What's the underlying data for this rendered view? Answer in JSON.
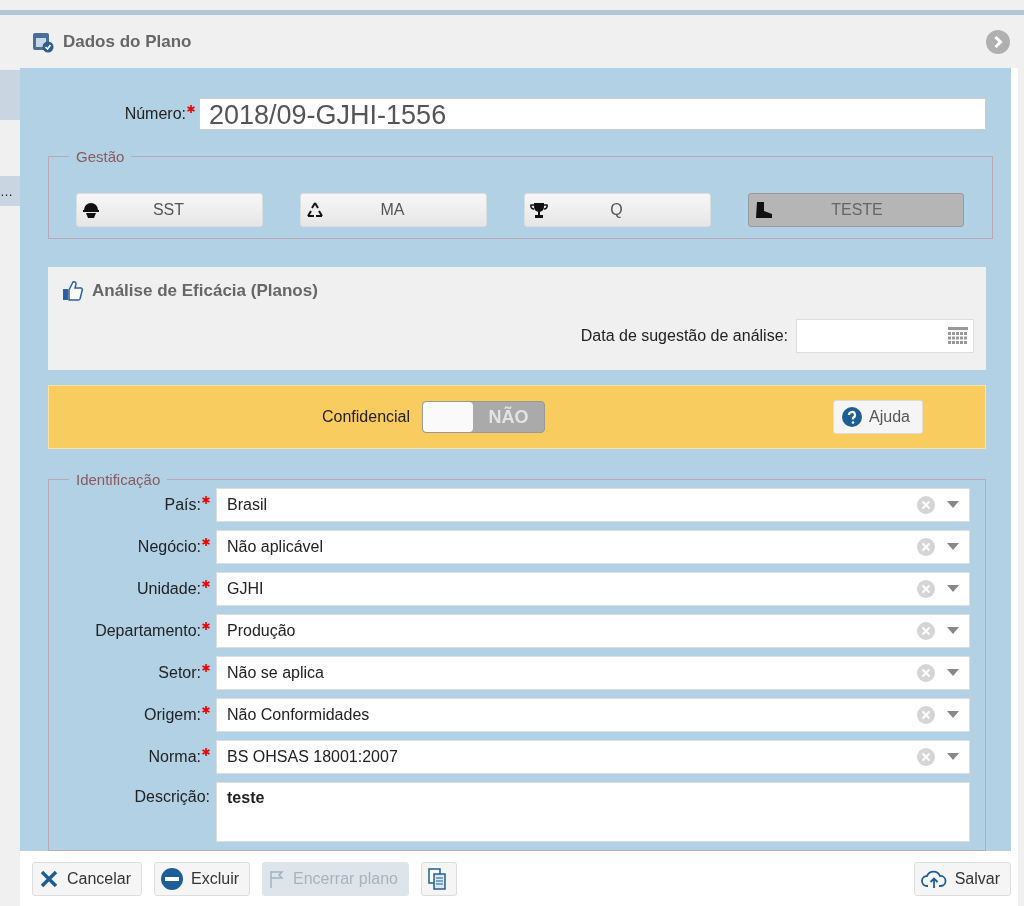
{
  "background": {
    "cut_text": "…"
  },
  "window": {
    "title": "Dados do Plano"
  },
  "numero": {
    "label": "Número:",
    "required": true,
    "value": "2018/09-GJHI-1556"
  },
  "gestao": {
    "legend": "Gestão",
    "buttons": [
      {
        "label": "SST",
        "kind": "helmet",
        "selected": false
      },
      {
        "label": "MA",
        "kind": "recycle",
        "selected": false
      },
      {
        "label": "Q",
        "kind": "trophy",
        "selected": false
      },
      {
        "label": "TESTE",
        "kind": "boot",
        "selected": true
      }
    ]
  },
  "eficacia": {
    "title": "Análise de Eficácia (Planos)",
    "date_label": "Data de sugestão de análise:"
  },
  "confidencial": {
    "label": "Confidencial",
    "on": false,
    "state_text": "NÃO",
    "help": "Ajuda"
  },
  "identificacao": {
    "legend": "Identificação",
    "fields": [
      {
        "label": "País:",
        "required": true,
        "kind": "select",
        "value": "Brasil"
      },
      {
        "label": "Negócio:",
        "required": true,
        "kind": "select",
        "value": "Não aplicável"
      },
      {
        "label": "Unidade:",
        "required": true,
        "kind": "select",
        "value": "GJHI"
      },
      {
        "label": "Departamento:",
        "required": true,
        "kind": "select",
        "value": "Produção"
      },
      {
        "label": "Setor:",
        "required": true,
        "kind": "select",
        "value": "Não se aplica"
      },
      {
        "label": "Origem:",
        "required": true,
        "kind": "select",
        "value": "Não Conformidades"
      },
      {
        "label": "Norma:",
        "required": true,
        "kind": "select",
        "value": "BS OHSAS 18001:2007"
      },
      {
        "label": "Descrição:",
        "required": false,
        "kind": "text",
        "value": "teste"
      }
    ]
  },
  "footer": {
    "buttons": [
      {
        "label": "Cancelar",
        "kind": "cancel",
        "disabled": false
      },
      {
        "label": "Excluir",
        "kind": "delete",
        "disabled": false
      },
      {
        "label": "Encerrar plano",
        "kind": "flag",
        "disabled": true
      },
      {
        "kind": "copy",
        "disabled": false
      }
    ],
    "save": {
      "label": "Salvar"
    }
  }
}
